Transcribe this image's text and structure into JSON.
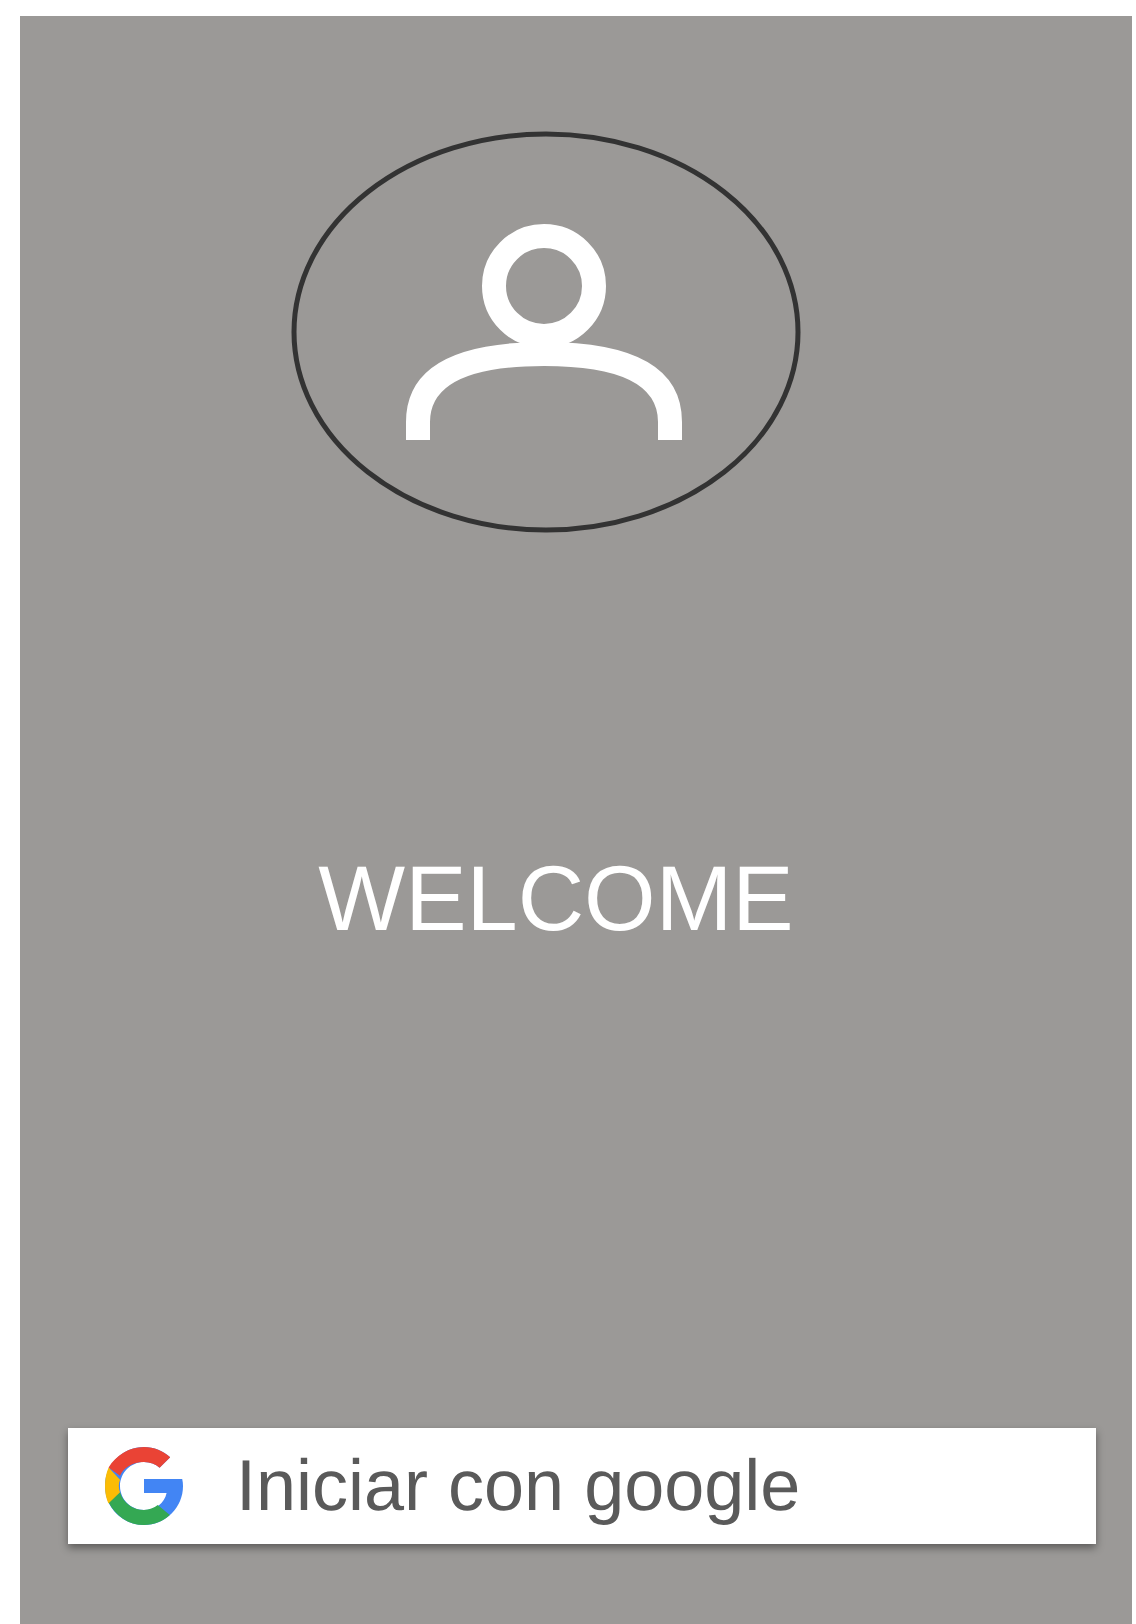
{
  "welcome": {
    "title": "WELCOME"
  },
  "google_button": {
    "label": "Iniciar con google"
  }
}
